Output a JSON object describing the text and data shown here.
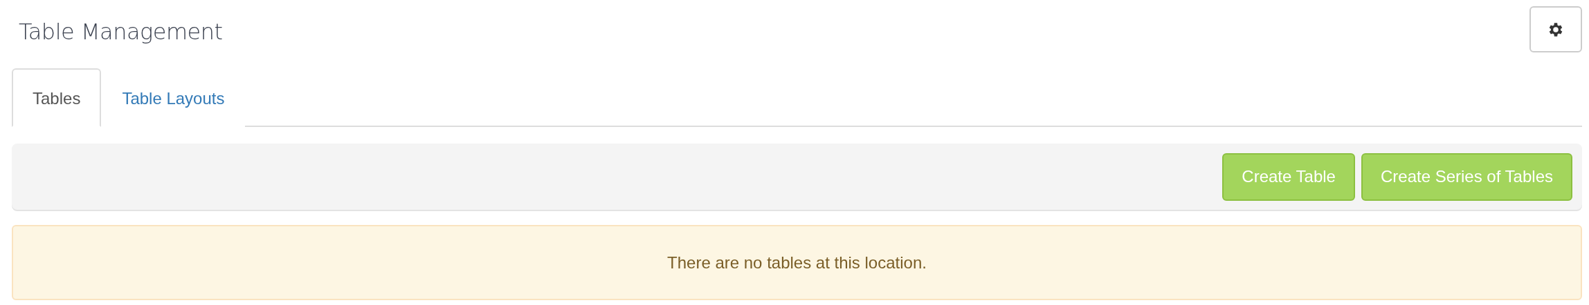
{
  "header": {
    "title": "Table Management"
  },
  "tabs": [
    {
      "label": "Tables",
      "selected": true
    },
    {
      "label": "Table Layouts",
      "selected": false
    }
  ],
  "toolbar": {
    "buttons": [
      "Create Table",
      "Create Series of Tables"
    ]
  },
  "alert": {
    "message": "There are no tables at this location."
  }
}
